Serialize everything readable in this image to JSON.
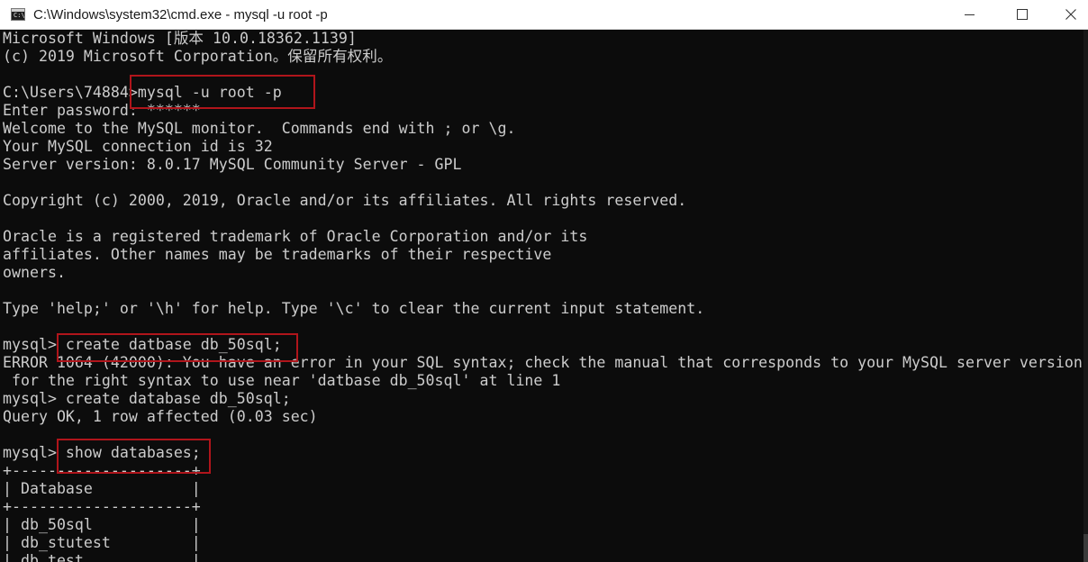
{
  "window": {
    "title": "C:\\Windows\\system32\\cmd.exe - mysql  -u root -p",
    "icon": "cmd-icon",
    "icon_glyph": "C:\\",
    "controls": {
      "minimize": "minimize-icon",
      "maximize": "maximize-icon",
      "close": "close-icon"
    }
  },
  "console": {
    "text_color": "#cccccc",
    "background": "#0c0c0c",
    "highlight_color": "#b0151b",
    "lines": [
      "Microsoft Windows [版本 10.0.18362.1139]",
      "(c) 2019 Microsoft Corporation。保留所有权利。",
      "",
      "C:\\Users\\74884>mysql -u root -p",
      "Enter password: ******",
      "Welcome to the MySQL monitor.  Commands end with ; or \\g.",
      "Your MySQL connection id is 32",
      "Server version: 8.0.17 MySQL Community Server - GPL",
      "",
      "Copyright (c) 2000, 2019, Oracle and/or its affiliates. All rights reserved.",
      "",
      "Oracle is a registered trademark of Oracle Corporation and/or its",
      "affiliates. Other names may be trademarks of their respective",
      "owners.",
      "",
      "Type 'help;' or '\\h' for help. Type '\\c' to clear the current input statement.",
      "",
      "mysql> create datbase db_50sql;",
      "ERROR 1064 (42000): You have an error in your SQL syntax; check the manual that corresponds to your MySQL server version",
      " for the right syntax to use near 'datbase db_50sql' at line 1",
      "mysql> create database db_50sql;",
      "Query OK, 1 row affected (0.03 sec)",
      "",
      "mysql> show databases;",
      "+--------------------+",
      "| Database           |",
      "+--------------------+",
      "| db_50sql           |",
      "| db_stutest         |",
      "| db_test            |"
    ]
  }
}
